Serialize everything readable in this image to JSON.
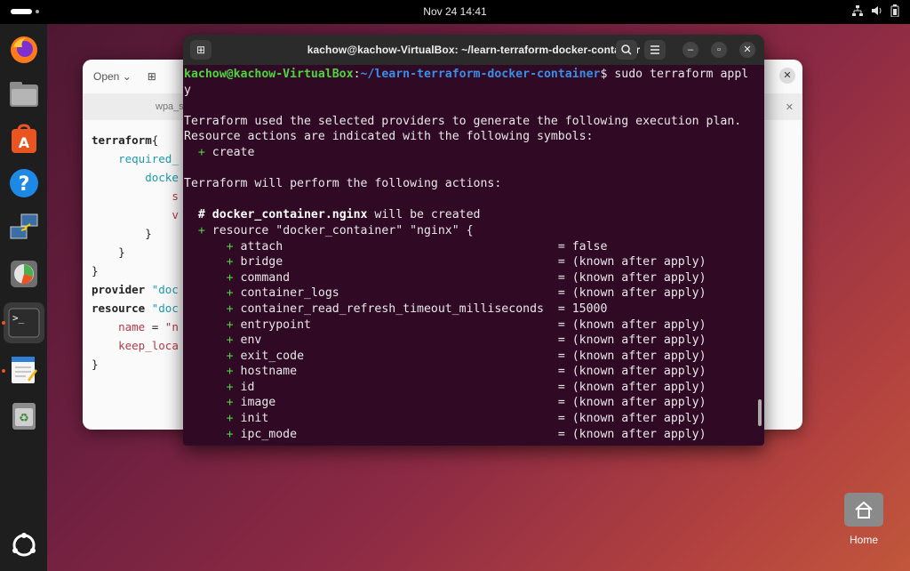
{
  "topbar": {
    "clock": "Nov 24  14:41",
    "tray_icons": [
      "network-icon",
      "volume-icon",
      "battery-icon"
    ]
  },
  "dock": {
    "items": [
      {
        "name": "firefox",
        "icon": "firefox-icon"
      },
      {
        "name": "files",
        "icon": "folder-icon"
      },
      {
        "name": "app-center",
        "icon": "store-icon"
      },
      {
        "name": "help",
        "icon": "help-icon"
      },
      {
        "name": "remote",
        "icon": "network-computer-icon"
      },
      {
        "name": "disk-usage",
        "icon": "disk-icon"
      },
      {
        "name": "terminal",
        "icon": "terminal-icon",
        "active": true
      },
      {
        "name": "text-editor",
        "icon": "text-editor-icon"
      },
      {
        "name": "trash",
        "icon": "trash-icon"
      }
    ],
    "apps_grid": "show-apps-icon"
  },
  "editor": {
    "open_label": "Open",
    "tab_label": "wpa_s",
    "lines": [
      {
        "indent": 0,
        "parts": [
          {
            "t": "terraform",
            "c": "kw"
          },
          {
            "t": "{",
            "c": ""
          }
        ]
      },
      {
        "indent": 1,
        "parts": [
          {
            "t": "required_",
            "c": "ind1"
          }
        ]
      },
      {
        "indent": 2,
        "parts": [
          {
            "t": "docke",
            "c": "ind1"
          }
        ]
      },
      {
        "indent": 3,
        "parts": [
          {
            "t": "s",
            "c": "str"
          }
        ]
      },
      {
        "indent": 3,
        "parts": [
          {
            "t": "v",
            "c": "str"
          }
        ]
      },
      {
        "indent": 2,
        "parts": [
          {
            "t": "}",
            "c": ""
          }
        ]
      },
      {
        "indent": 1,
        "parts": [
          {
            "t": "}",
            "c": ""
          }
        ]
      },
      {
        "indent": 0,
        "parts": [
          {
            "t": "}",
            "c": ""
          }
        ]
      },
      {
        "indent": 0,
        "parts": [
          {
            "t": "",
            "c": ""
          }
        ]
      },
      {
        "indent": 0,
        "parts": [
          {
            "t": "provider ",
            "c": "kw"
          },
          {
            "t": "\"doc",
            "c": "ind1"
          }
        ]
      },
      {
        "indent": 0,
        "parts": [
          {
            "t": "",
            "c": ""
          }
        ]
      },
      {
        "indent": 0,
        "parts": [
          {
            "t": "resource ",
            "c": "kw"
          },
          {
            "t": "\"doc",
            "c": "ind1"
          }
        ]
      },
      {
        "indent": 1,
        "parts": [
          {
            "t": "name",
            "c": "str"
          },
          {
            "t": " = ",
            "c": ""
          },
          {
            "t": "\"n",
            "c": "str"
          }
        ]
      },
      {
        "indent": 1,
        "parts": [
          {
            "t": "keep_loca",
            "c": "str"
          }
        ]
      },
      {
        "indent": 0,
        "parts": [
          {
            "t": "}",
            "c": ""
          }
        ]
      }
    ]
  },
  "terminal": {
    "title": "kachow@kachow-VirtualBox: ~/learn-terraform-docker-container",
    "prompt_user": "kachow@kachow-VirtualBox",
    "prompt_sep": ":",
    "prompt_path": "~/learn-terraform-docker-container",
    "command": "$ sudo terraform appl",
    "command_wrap": "y",
    "text_lines": [
      "",
      "Terraform used the selected providers to generate the following execution plan.",
      "Resource actions are indicated with the following symbols:"
    ],
    "create_symbol": "+",
    "create_label": "create",
    "perform_line": "Terraform will perform the following actions:",
    "resource_comment_hash": "# ",
    "resource_comment_name": "docker_container.nginx",
    "resource_comment_rest": " will be created",
    "resource_decl": "resource \"docker_container\" \"nginx\" {",
    "attributes": [
      {
        "key": "attach",
        "value": "= false"
      },
      {
        "key": "bridge",
        "value": "= (known after apply)"
      },
      {
        "key": "command",
        "value": "= (known after apply)"
      },
      {
        "key": "container_logs",
        "value": "= (known after apply)"
      },
      {
        "key": "container_read_refresh_timeout_milliseconds",
        "value": "= 15000"
      },
      {
        "key": "entrypoint",
        "value": "= (known after apply)"
      },
      {
        "key": "env",
        "value": "= (known after apply)"
      },
      {
        "key": "exit_code",
        "value": "= (known after apply)"
      },
      {
        "key": "hostname",
        "value": "= (known after apply)"
      },
      {
        "key": "id",
        "value": "= (known after apply)"
      },
      {
        "key": "image",
        "value": "= (known after apply)"
      },
      {
        "key": "init",
        "value": "= (known after apply)"
      },
      {
        "key": "ipc_mode",
        "value": "= (known after apply)"
      }
    ]
  },
  "desktop": {
    "home_label": "Home"
  }
}
